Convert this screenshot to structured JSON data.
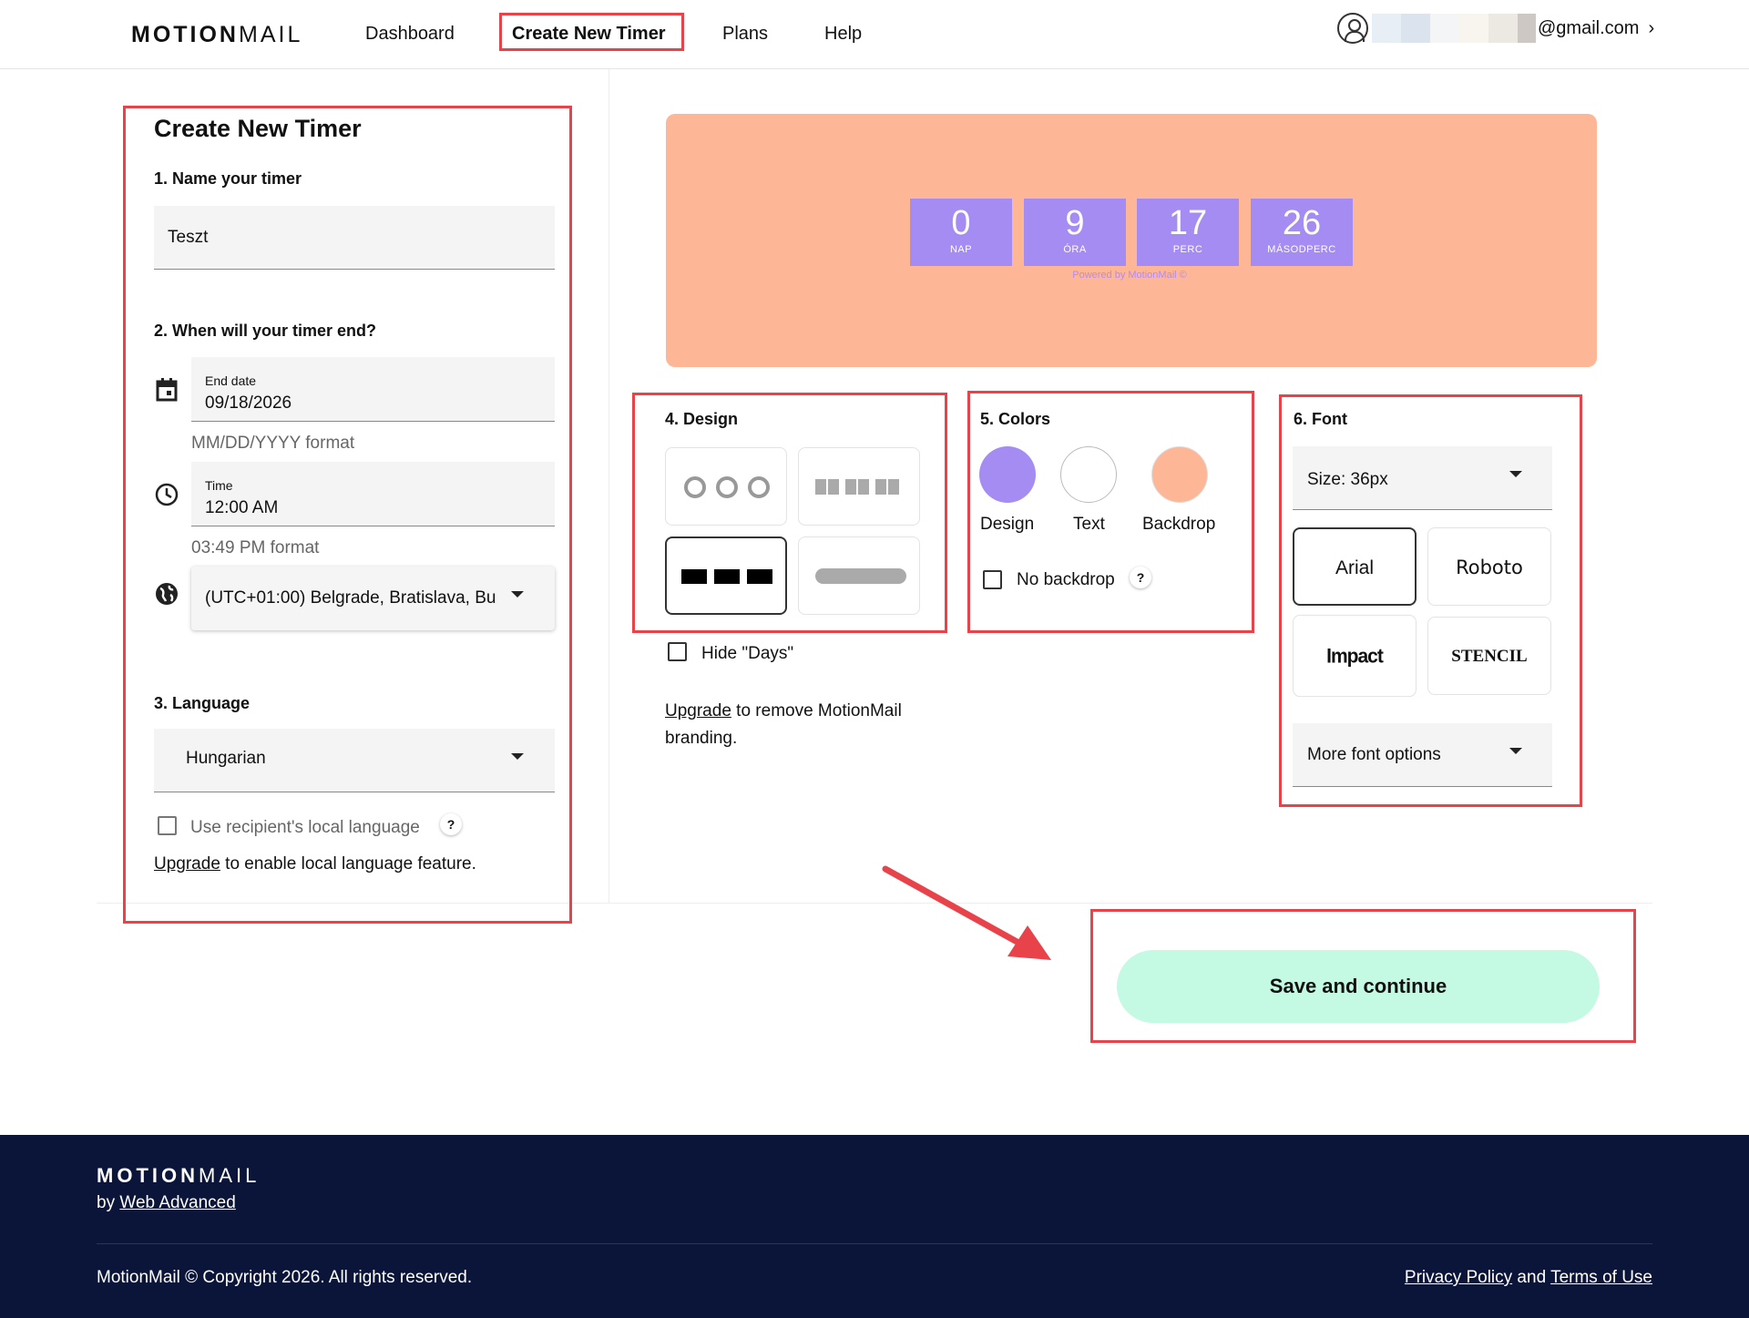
{
  "header": {
    "logo_bold": "MOTION",
    "logo_light": "MAIL",
    "nav": [
      "Dashboard",
      "Create New Timer",
      "Plans",
      "Help"
    ],
    "active_nav": "Create New Timer",
    "email": "@gmail.com",
    "email_chevron": "›",
    "email_redaction_colors": [
      "#e7eef6",
      "#dbe4ee",
      "#f3f5f7",
      "#f8f5ef",
      "#ece8e2",
      "#cdc8c4"
    ]
  },
  "form": {
    "title": "Create New Timer",
    "step1_label": "1. Name your timer",
    "timer_name": "Teszt",
    "step2_label": "2. When will your timer end?",
    "end_date_caption": "End date",
    "end_date": "09/18/2026",
    "date_hint": "MM/DD/YYYY format",
    "time_caption": "Time",
    "time": "12:00 AM",
    "time_hint": "03:49 PM format",
    "timezone": "(UTC+01:00) Belgrade, Bratislava, Bu",
    "step3_label": "3. Language",
    "language": "Hungarian",
    "local_language_label": "Use recipient's local language",
    "local_language_checked": false,
    "upgrade_link": "Upgrade",
    "upgrade_text": " to enable local language feature.",
    "help_mark": "?"
  },
  "preview": {
    "background_color": "#fdb797",
    "box_color": "#a58cf3",
    "units": [
      {
        "value": "0",
        "label": "NAP"
      },
      {
        "value": "9",
        "label": "ÓRA"
      },
      {
        "value": "17",
        "label": "PERC"
      },
      {
        "value": "26",
        "label": "MÁSODPERC"
      }
    ],
    "powered_by": "Powered by MotionMail ©"
  },
  "design": {
    "label": "4. Design",
    "selected_index": 2,
    "hide_days_label": "Hide \"Days\"",
    "hide_days_checked": false,
    "upgrade_link": "Upgrade",
    "upgrade_text": " to remove MotionMail",
    "upgrade_text2": "branding."
  },
  "colors": {
    "label": "5. Colors",
    "swatches": [
      {
        "name": "Design",
        "color": "#a58cf3"
      },
      {
        "name": "Text",
        "color": "#ffffff"
      },
      {
        "name": "Backdrop",
        "color": "#fdb797"
      }
    ],
    "no_backdrop_label": "No backdrop",
    "no_backdrop_checked": false,
    "help_mark": "?"
  },
  "font": {
    "label": "6. Font",
    "size": "Size: 36px",
    "options": [
      "Arial",
      "Roboto",
      "Impact",
      "STENCIL"
    ],
    "selected": "Arial",
    "more": "More font options"
  },
  "actions": {
    "save_label": "Save and continue"
  },
  "footer": {
    "logo_bold": "MOTION",
    "logo_light": "MAIL",
    "by_text": "by ",
    "by_link": "Web Advanced",
    "copyright": "MotionMail © Copyright 2026. All rights reserved.",
    "privacy": "Privacy Policy",
    "and": " and ",
    "terms": "Terms of Use"
  },
  "annotation_color": "#e8434a"
}
